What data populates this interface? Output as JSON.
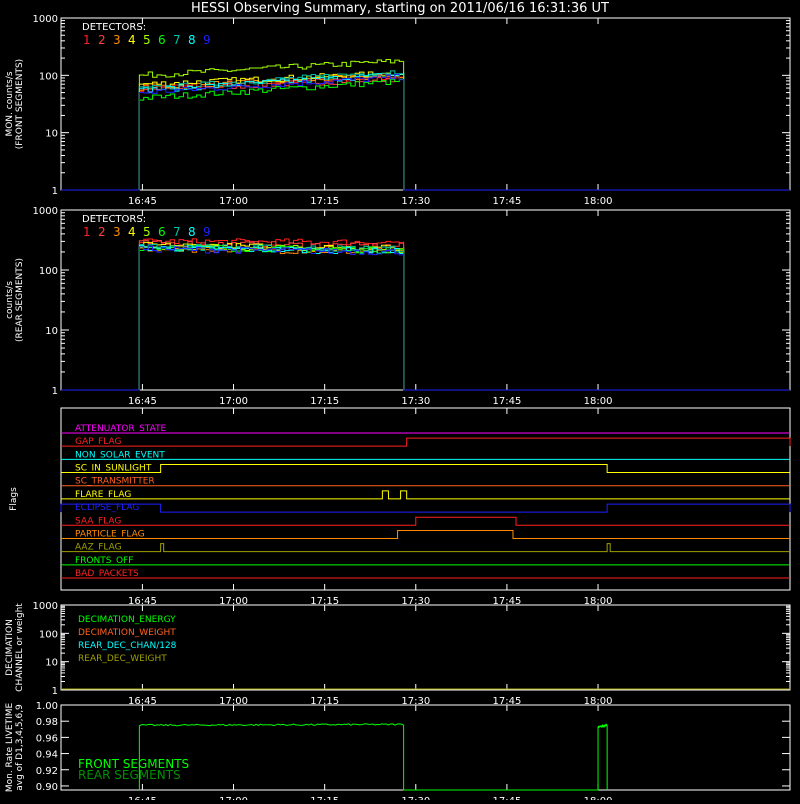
{
  "title": "HESSI Observing Summary, starting on 2011/06/16 16:31:36 UT",
  "time_ticks": [
    "16:45",
    "17:00",
    "17:15",
    "17:30",
    "17:45",
    "18:00"
  ],
  "colors": {
    "magenta": "#ff00ff",
    "red": "#ff2020",
    "orange": "#ff8c00",
    "yellow": "#ffff00",
    "green": "#00ff00",
    "cyan": "#00ffff",
    "blue": "#2020ff",
    "olive": "#a0a000",
    "white": "#ffffff"
  },
  "chart_data": [
    {
      "id": "front",
      "type": "line",
      "legend_title": "DETECTORS:",
      "ylabel": "MON. counts/s",
      "ylabel2": "(FRONT SEGMENTS)",
      "y_log": true,
      "ylim": [
        1,
        1000
      ],
      "y_ticks": [
        "1",
        "10",
        "100",
        "1000"
      ],
      "xlim": [
        "16:31:36",
        "18:31:36"
      ],
      "series": [
        {
          "name": "1",
          "color": "#ff2020",
          "start": "16:44:30",
          "end": "17:28:00",
          "level_start": 60,
          "level_end": 95
        },
        {
          "name": "2",
          "color": "#ff4040",
          "start": "16:44:30",
          "end": "17:28:00",
          "level_start": 55,
          "level_end": 90
        },
        {
          "name": "3",
          "color": "#ff8c00",
          "start": "16:44:30",
          "end": "17:28:00",
          "level_start": 62,
          "level_end": 100
        },
        {
          "name": "4",
          "color": "#ffff00",
          "start": "16:44:30",
          "end": "17:28:00",
          "level_start": 70,
          "level_end": 110
        },
        {
          "name": "5",
          "color": "#a0ff00",
          "start": "16:44:30",
          "end": "17:28:00",
          "level_start": 100,
          "level_end": 180
        },
        {
          "name": "6",
          "color": "#00ff00",
          "start": "16:44:30",
          "end": "17:28:00",
          "level_start": 40,
          "level_end": 80
        },
        {
          "name": "7",
          "color": "#00c0a0",
          "start": "16:44:30",
          "end": "17:28:00",
          "level_start": 58,
          "level_end": 120
        },
        {
          "name": "8",
          "color": "#00ffff",
          "start": "16:44:30",
          "end": "17:28:00",
          "level_start": 55,
          "level_end": 105
        },
        {
          "name": "9",
          "color": "#2020ff",
          "start": "16:44:30",
          "end": "17:28:00",
          "level_start": 50,
          "level_end": 95
        }
      ]
    },
    {
      "id": "rear",
      "type": "line",
      "legend_title": "DETECTORS:",
      "ylabel": "counts/s",
      "ylabel2": "(REAR SEGMENTS)",
      "y_log": true,
      "ylim": [
        1,
        1000
      ],
      "y_ticks": [
        "1",
        "10",
        "100",
        "1000"
      ],
      "xlim": [
        "16:31:36",
        "18:31:36"
      ],
      "series": [
        {
          "name": "1",
          "color": "#ff2020",
          "start": "16:44:30",
          "end": "17:28:00",
          "level_start": 300,
          "level_end": 290
        },
        {
          "name": "2",
          "color": "#ff4040",
          "start": "16:44:30",
          "end": "17:28:00",
          "level_start": 280,
          "level_end": 250
        },
        {
          "name": "3",
          "color": "#ff8c00",
          "start": "16:44:30",
          "end": "17:28:00",
          "level_start": 230,
          "level_end": 200
        },
        {
          "name": "4",
          "color": "#ffff00",
          "start": "16:44:30",
          "end": "17:28:00",
          "level_start": 260,
          "level_end": 230
        },
        {
          "name": "5",
          "color": "#a0ff00",
          "start": "16:44:30",
          "end": "17:28:00",
          "level_start": 250,
          "level_end": 220
        },
        {
          "name": "6",
          "color": "#00ff00",
          "start": "16:44:30",
          "end": "17:28:00",
          "level_start": 240,
          "level_end": 215
        },
        {
          "name": "7",
          "color": "#00c0a0",
          "start": "16:44:30",
          "end": "17:28:00",
          "level_start": 245,
          "level_end": 225
        },
        {
          "name": "8",
          "color": "#00ffff",
          "start": "16:44:30",
          "end": "17:28:00",
          "level_start": 235,
          "level_end": 205
        },
        {
          "name": "9",
          "color": "#2020ff",
          "start": "16:44:30",
          "end": "17:28:00",
          "level_start": 225,
          "level_end": 200
        }
      ]
    },
    {
      "id": "flags",
      "type": "line",
      "ylabel": "Flags",
      "xlim": [
        "16:31:36",
        "18:31:36"
      ],
      "flags": [
        {
          "name": "ATTENUATOR_STATE",
          "color": "#ff00ff",
          "high": []
        },
        {
          "name": "GAP_FLAG",
          "color": "#ff2020",
          "high": [
            [
              "17:28:30",
              "18:31:36"
            ]
          ]
        },
        {
          "name": "NON_SOLAR_EVENT",
          "color": "#00ffff",
          "high": []
        },
        {
          "name": "SC_IN_SUNLIGHT",
          "color": "#ffff00",
          "high": [
            [
              "16:48:00",
              "18:01:30"
            ]
          ]
        },
        {
          "name": "SC_TRANSMITTER",
          "color": "#ff6020",
          "high": []
        },
        {
          "name": "FLARE_FLAG",
          "color": "#ffff00",
          "high": [
            [
              "17:24:30",
              "17:25:30"
            ],
            [
              "17:27:30",
              "17:28:30"
            ]
          ]
        },
        {
          "name": "ECLIPSE_FLAG",
          "color": "#2020ff",
          "high": [
            [
              "16:31:36",
              "16:48:00"
            ],
            [
              "18:01:30",
              "18:31:36"
            ]
          ]
        },
        {
          "name": "SAA_FLAG",
          "color": "#ff2020",
          "high": [
            [
              "17:30:00",
              "17:46:30"
            ]
          ]
        },
        {
          "name": "PARTICLE_FLAG",
          "color": "#ff8c00",
          "high": [
            [
              "17:27:00",
              "17:46:00"
            ]
          ]
        },
        {
          "name": "AAZ_FLAG",
          "color": "#a0a000",
          "high": [
            [
              "16:48:00",
              "16:48:30"
            ],
            [
              "18:01:30",
              "18:02:00"
            ]
          ]
        },
        {
          "name": "FRONTS_OFF",
          "color": "#00ff00",
          "high": []
        },
        {
          "name": "BAD_PACKETS",
          "color": "#ff2020",
          "high": []
        }
      ]
    },
    {
      "id": "decimation",
      "type": "line",
      "ylabel": "DECIMATION",
      "ylabel2": "CHANNEL or weight",
      "y_log": true,
      "ylim": [
        1,
        1000
      ],
      "y_ticks": [
        "1",
        "10",
        "100",
        "1000"
      ],
      "xlim": [
        "16:31:36",
        "18:31:36"
      ],
      "series": [
        {
          "name": "DECIMATION_ENERGY",
          "color": "#00ff00"
        },
        {
          "name": "DECIMATION_WEIGHT",
          "color": "#ff6020"
        },
        {
          "name": "REAR_DEC_CHAN/128",
          "color": "#00ffff"
        },
        {
          "name": "REAR_DEC_WEIGHT",
          "color": "#a0a000"
        }
      ]
    },
    {
      "id": "livetime",
      "type": "line",
      "ylabel": "Mon. Rate LIVETIME",
      "ylabel2": "avg of D1,3,4,5,6,9",
      "ylim": [
        0.895,
        1.0
      ],
      "y_ticks": [
        "0.90",
        "0.92",
        "0.94",
        "0.96",
        "0.98",
        "1.00"
      ],
      "xlim": [
        "16:31:36",
        "18:31:36"
      ],
      "series": [
        {
          "name": "FRONT SEGMENTS",
          "color": "#00ff00",
          "segments": [
            [
              "16:44:30",
              "17:28:00",
              0.975,
              0.976
            ],
            [
              "18:00:00",
              "18:01:30",
              0.973,
              0.975
            ]
          ]
        },
        {
          "name": "REAR SEGMENTS",
          "color": "#009000",
          "segments": []
        }
      ]
    }
  ]
}
